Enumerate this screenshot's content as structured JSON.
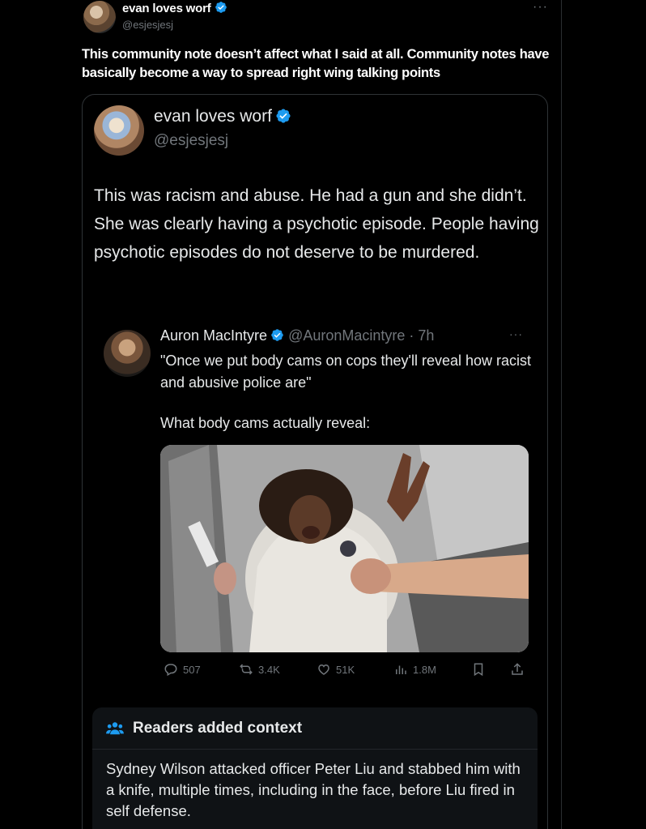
{
  "post": {
    "author_name": "evan loves worf",
    "author_handle": "@esjesjesj",
    "text": "This community note doesn’t affect what I said at all. Community notes have basically become a way to spread right wing talking points",
    "more_glyph": "···"
  },
  "quoted_post": {
    "author_name": "evan loves worf",
    "author_handle": "@esjesjesj",
    "text": "This was racism and abuse. He had a gun and she didn’t. She was clearly having a psychotic episode. People having psychotic episodes do not deserve to be murdered."
  },
  "nested_post": {
    "author_name": "Auron MacIntyre",
    "author_handle_time": "@AuronMacintyre · 7h",
    "more_glyph": "···",
    "text": "\"Once we put body cams on cops they'll reveal how racist and abusive police are\"",
    "text2": "What body cams actually reveal:",
    "stats": {
      "replies": "507",
      "reposts": "3.4K",
      "likes": "51K",
      "views": "1.8M"
    }
  },
  "community_note": {
    "title": "Readers added context",
    "text": "Sydney Wilson attacked officer Peter Liu and stabbed him with a knife, multiple times, including in the face, before Liu fired in self defense."
  },
  "colors": {
    "background": "#000000",
    "text_primary": "#e7e9ea",
    "text_secondary": "#71767b",
    "verified_blue": "#1d9bf0",
    "border": "#2f3336",
    "note_background": "#0f1215"
  },
  "icons": [
    "verified-badge-icon",
    "more-icon",
    "reply-icon",
    "repost-icon",
    "like-icon",
    "views-icon",
    "bookmark-icon",
    "share-icon",
    "people-icon"
  ]
}
